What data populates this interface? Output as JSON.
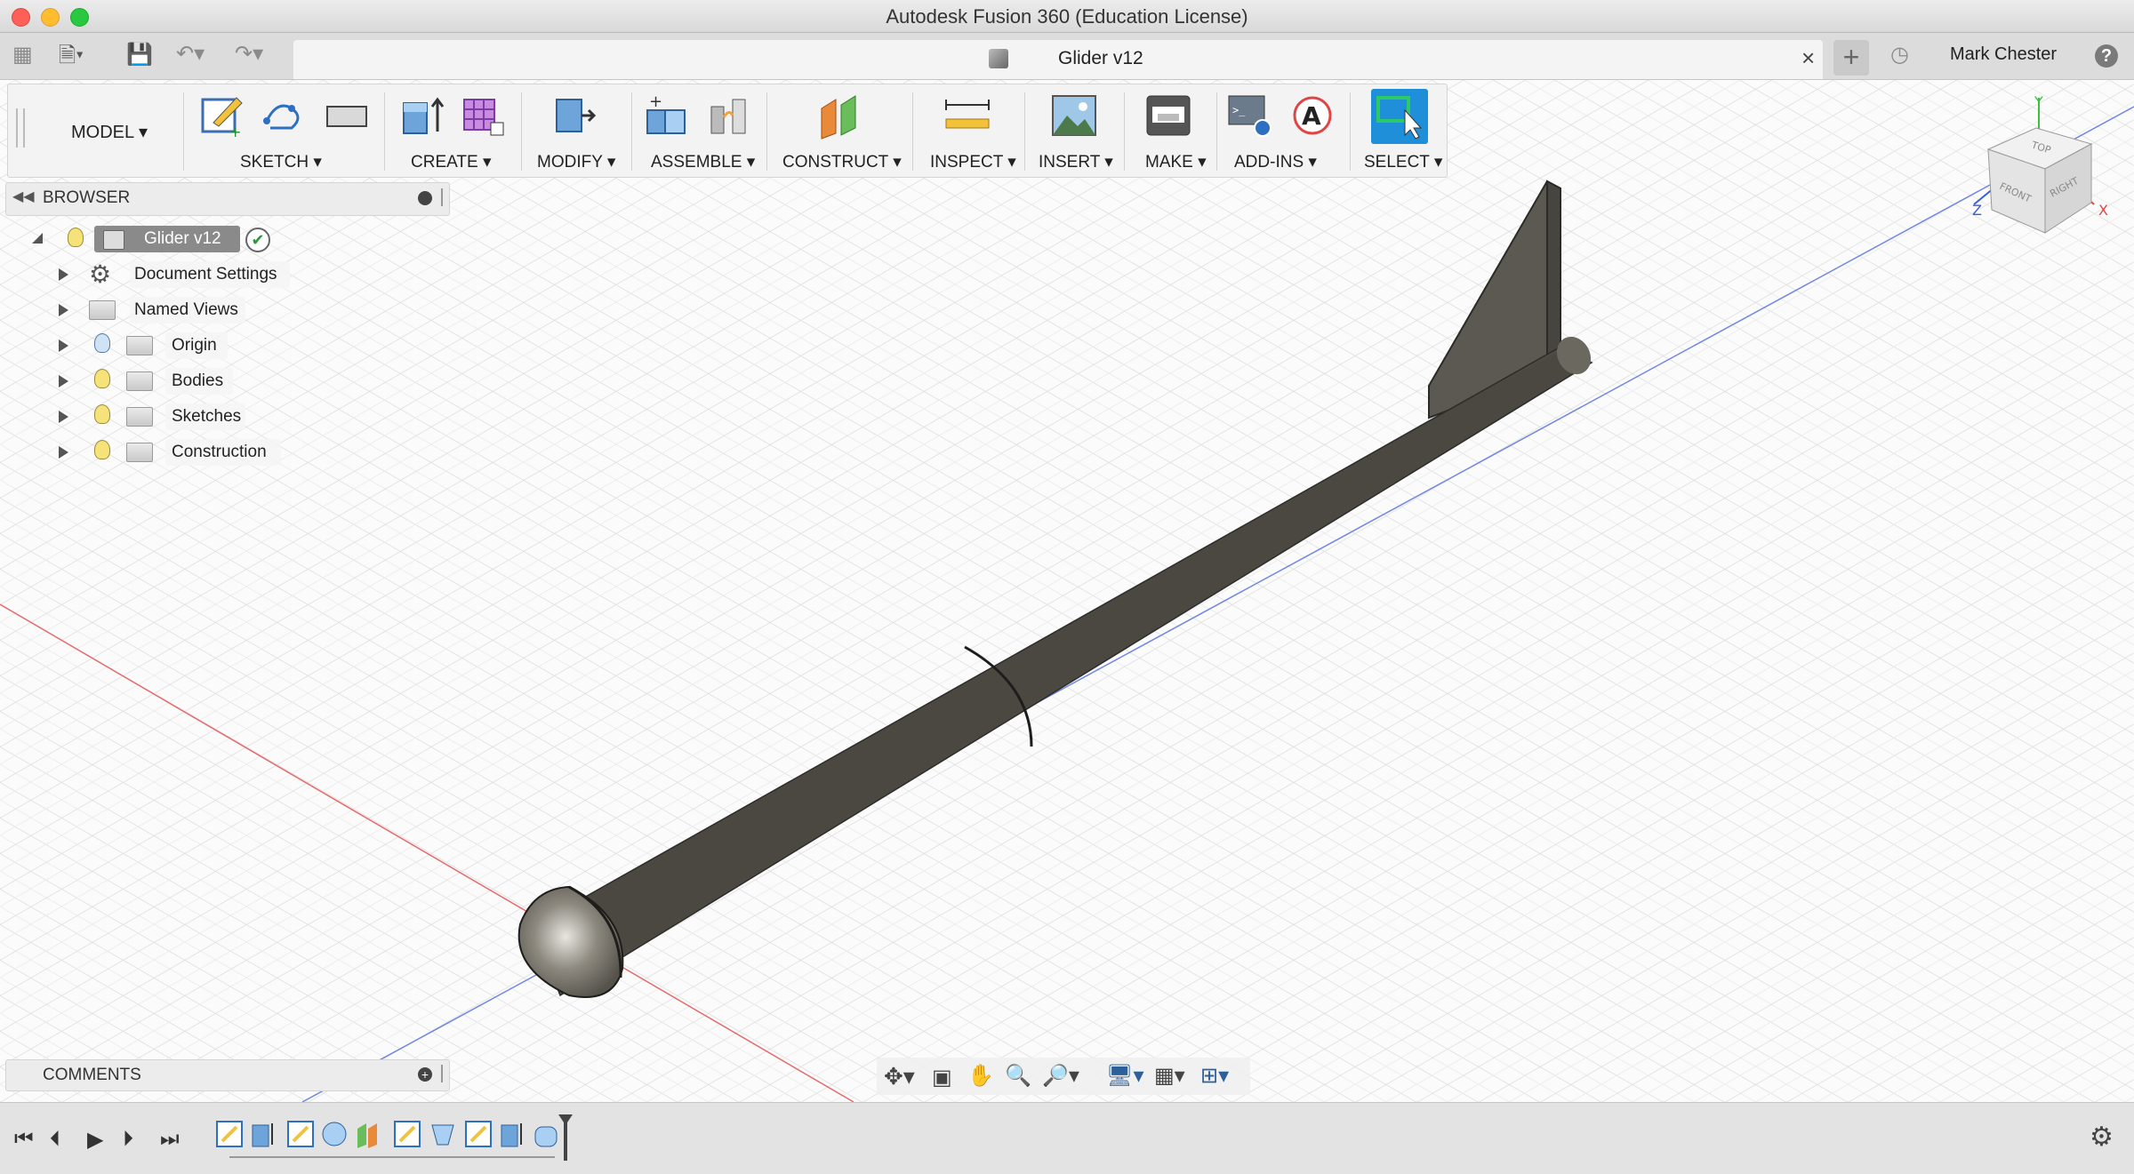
{
  "window": {
    "title": "Autodesk Fusion 360 (Education License)"
  },
  "tab": {
    "label": "Glider v12"
  },
  "user": {
    "name": "Mark Chester"
  },
  "workspace": {
    "label": "MODEL"
  },
  "toolbar": {
    "groups": [
      "SKETCH",
      "CREATE",
      "MODIFY",
      "ASSEMBLE",
      "CONSTRUCT",
      "INSPECT",
      "INSERT",
      "MAKE",
      "ADD-INS",
      "SELECT"
    ]
  },
  "browser": {
    "title": "BROWSER",
    "root": "Glider v12",
    "items": [
      "Document Settings",
      "Named Views",
      "Origin",
      "Bodies",
      "Sketches",
      "Construction"
    ]
  },
  "comments": {
    "title": "COMMENTS"
  },
  "viewcube": {
    "top": "TOP",
    "front": "FRONT",
    "right": "RIGHT",
    "axes": [
      "Y",
      "Z",
      "X"
    ]
  },
  "colors": {
    "select_active": "#1e8fd8",
    "axis_x": "#e04545",
    "axis_z": "#3a5fd8",
    "axis_y": "#3cc040"
  }
}
